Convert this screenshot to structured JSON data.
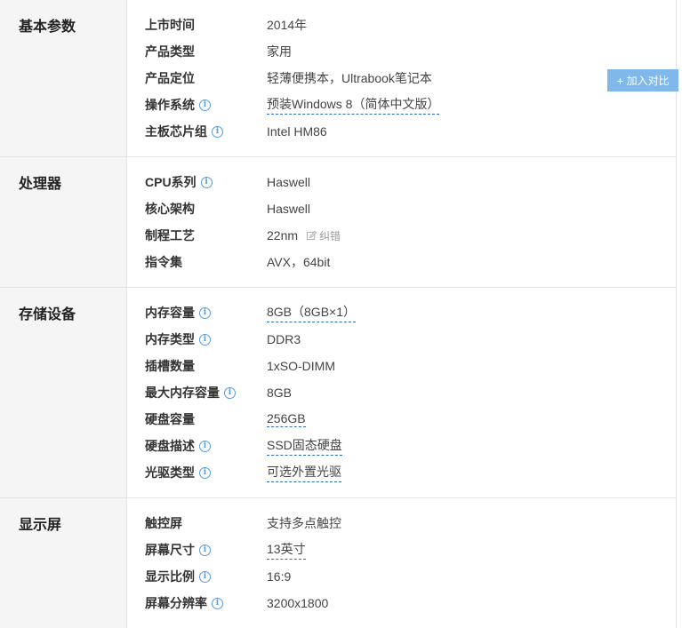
{
  "compare_button": {
    "icon": "plus-icon",
    "label": "加入对比"
  },
  "correction": {
    "icon": "edit-icon",
    "label": "纠错"
  },
  "sections": {
    "basic": {
      "title": "基本参数",
      "rows": [
        {
          "label": "上市时间",
          "value": "2014年"
        },
        {
          "label": "产品类型",
          "value": "家用"
        },
        {
          "label": "产品定位",
          "value": "轻薄便携本，Ultrabook笔记本"
        },
        {
          "label": "操作系统",
          "value": "预装Windows 8（简体中文版）"
        },
        {
          "label": "主板芯片组",
          "value": "Intel HM86"
        }
      ]
    },
    "cpu": {
      "title": "处理器",
      "rows": [
        {
          "label": "CPU系列",
          "value": "Haswell"
        },
        {
          "label": "核心架构",
          "value": "Haswell"
        },
        {
          "label": "制程工艺",
          "value": "22nm"
        },
        {
          "label": "指令集",
          "value": "AVX，64bit"
        }
      ]
    },
    "storage": {
      "title": "存储设备",
      "rows": [
        {
          "label": "内存容量",
          "value": "8GB（8GB×1）"
        },
        {
          "label": "内存类型",
          "value": "DDR3"
        },
        {
          "label": "插槽数量",
          "value": "1xSO-DIMM"
        },
        {
          "label": "最大内存容量",
          "value": "8GB"
        },
        {
          "label": "硬盘容量",
          "value": "256GB"
        },
        {
          "label": "硬盘描述",
          "value": "SSD固态硬盘"
        },
        {
          "label": "光驱类型",
          "value": "可选外置光驱"
        }
      ]
    },
    "display": {
      "title": "显示屏",
      "rows": [
        {
          "label": "触控屏",
          "value": "支持多点触控"
        },
        {
          "label": "屏幕尺寸",
          "value": "13英寸"
        },
        {
          "label": "显示比例",
          "value": "16:9"
        },
        {
          "label": "屏幕分辨率",
          "value": "3200x1800"
        }
      ]
    }
  }
}
